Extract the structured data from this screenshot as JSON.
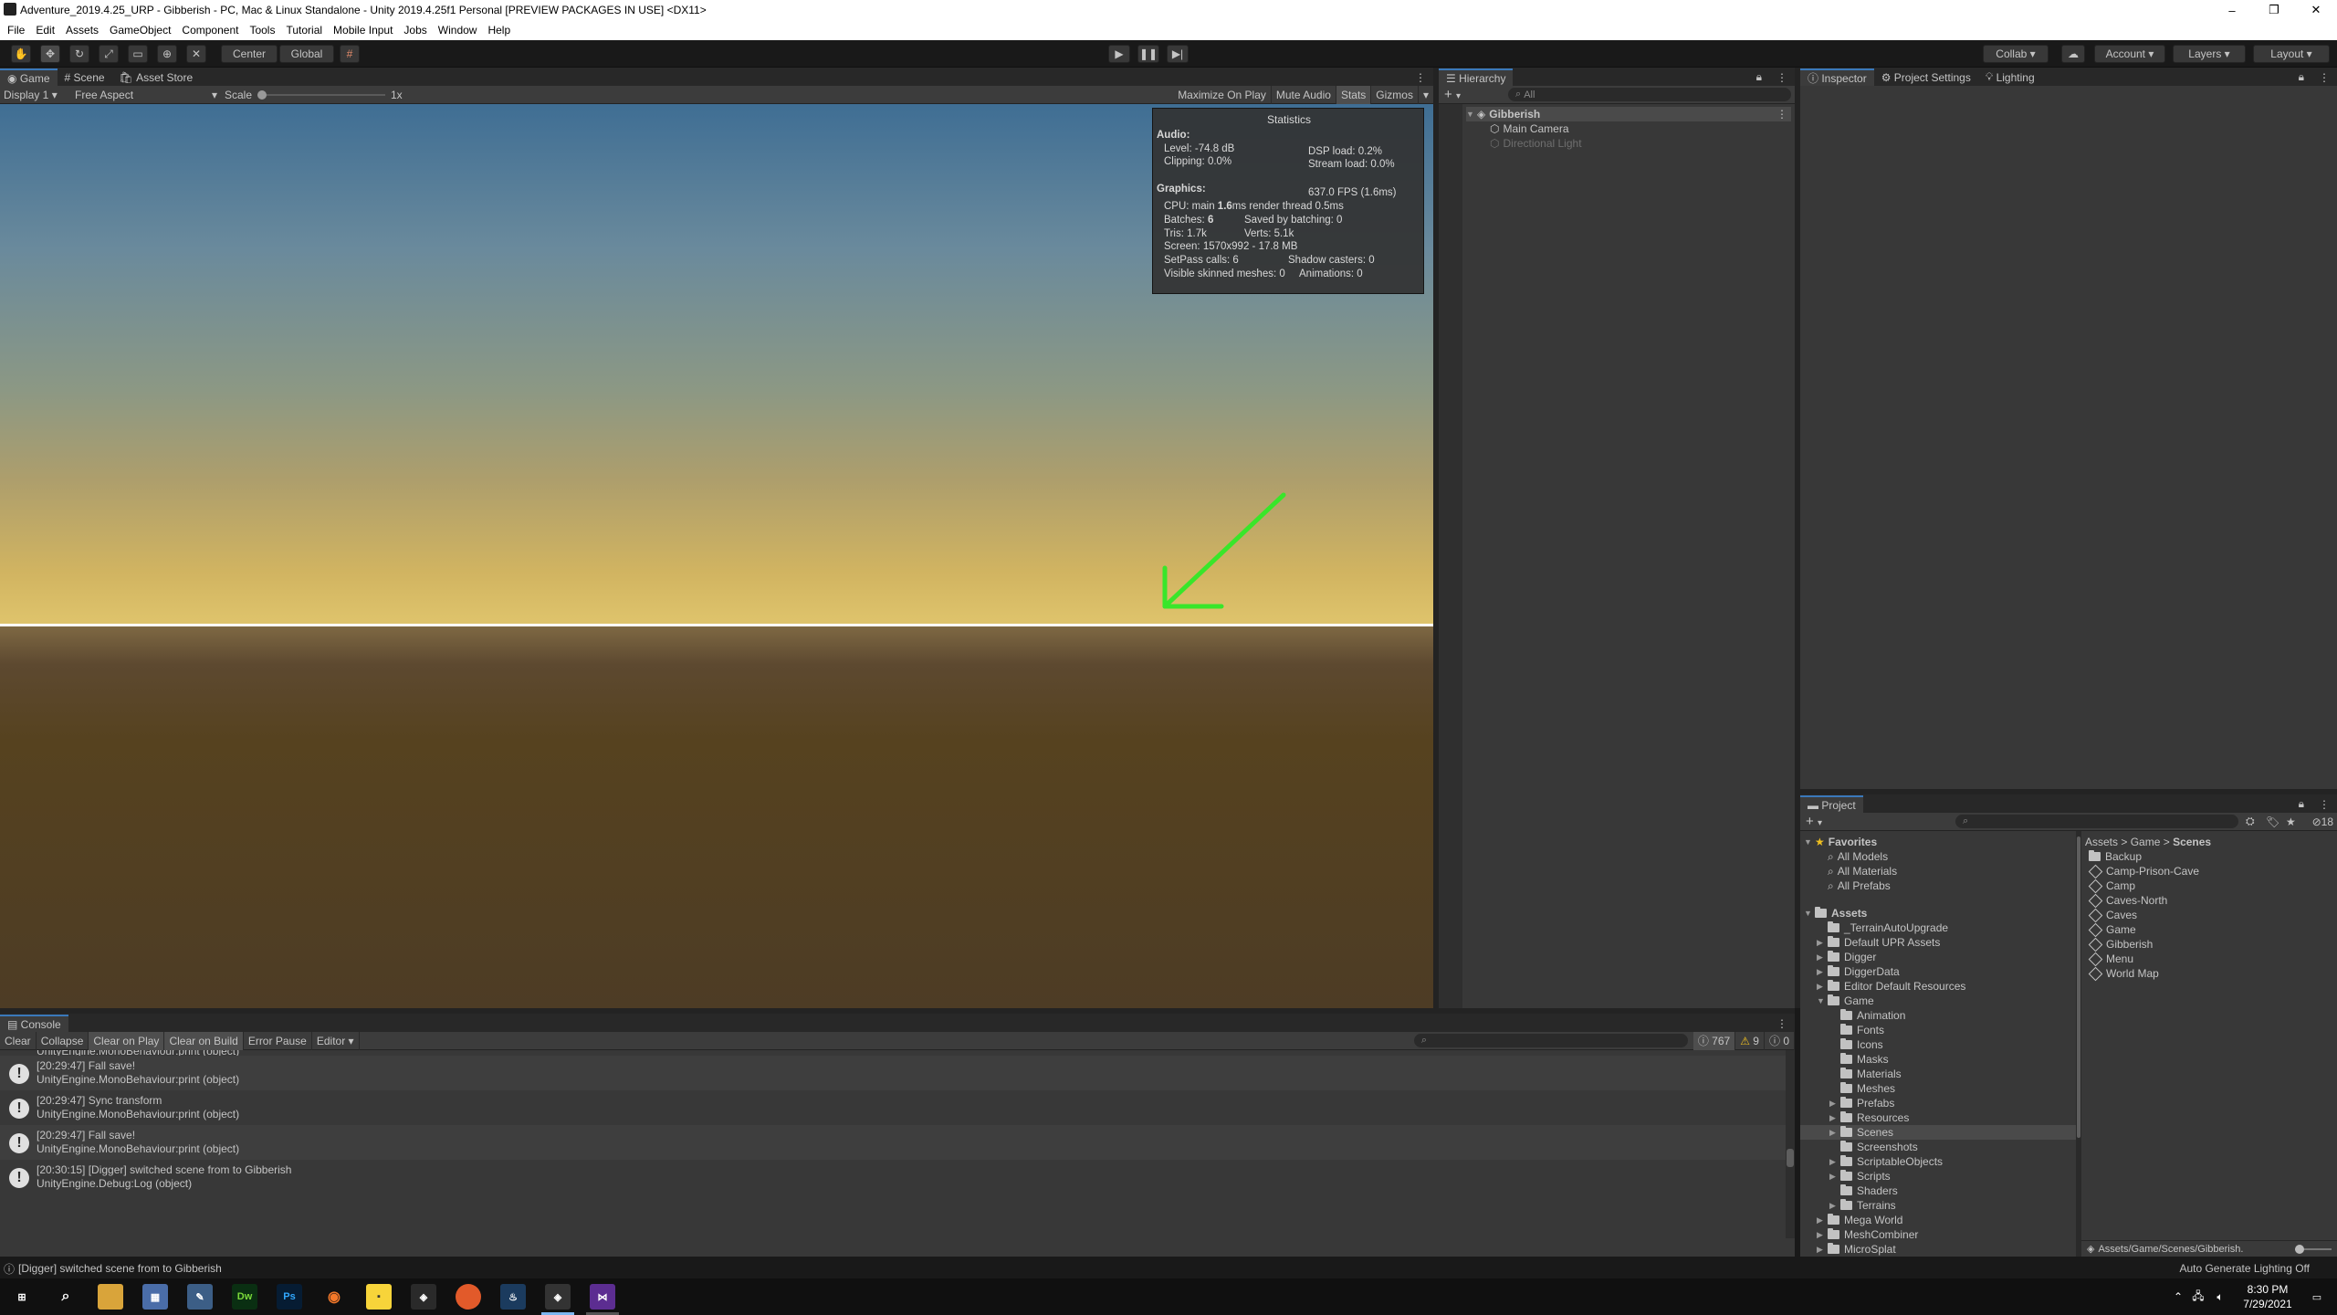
{
  "window": {
    "title": "Adventure_2019.4.25_URP - Gibberish - PC, Mac & Linux Standalone - Unity 2019.4.25f1 Personal [PREVIEW PACKAGES IN USE] <DX11>",
    "controls": [
      "–",
      "❐",
      "✕"
    ]
  },
  "menu": [
    "File",
    "Edit",
    "Assets",
    "GameObject",
    "Component",
    "Tools",
    "Tutorial",
    "Mobile Input",
    "Jobs",
    "Window",
    "Help"
  ],
  "toolbar": {
    "pivot": "Center",
    "space": "Global",
    "collab": "Collab",
    "account": "Account",
    "layers": "Layers",
    "layout": "Layout"
  },
  "game_view": {
    "tabs": [
      "Game",
      "Scene",
      "Asset Store"
    ],
    "display": "Display 1",
    "aspect": "Free Aspect",
    "scale_label": "Scale",
    "scale_value": "1x",
    "buttons": [
      "Maximize On Play",
      "Mute Audio",
      "Stats",
      "Gizmos"
    ],
    "arrow_color": "#39e62a"
  },
  "stats": {
    "title": "Statistics",
    "audio_header": "Audio:",
    "level": "Level: -74.8 dB",
    "clipping": "Clipping: 0.0%",
    "dsp": "DSP load: 0.2%",
    "stream": "Stream load: 0.0%",
    "graphics_header": "Graphics:",
    "fps": "637.0 FPS (1.6ms)",
    "cpu_a": "CPU: main ",
    "cpu_b": "1.6",
    "cpu_c": "ms  render thread 0.5ms",
    "batches_a": "Batches: ",
    "batches_b": "6",
    "saved": "Saved by batching: 0",
    "tris": "Tris: 1.7k",
    "verts": "Verts: 5.1k",
    "screen": "Screen: 1570x992 - 17.8 MB",
    "setpass": "SetPass calls: 6",
    "shadow": "Shadow casters: 0",
    "skinned": "Visible skinned meshes: 0",
    "anims": "Animations: 0"
  },
  "hierarchy": {
    "tab": "Hierarchy",
    "search_placeholder": "All",
    "scene": "Gibberish",
    "items": [
      "Main Camera",
      "Directional Light"
    ]
  },
  "inspector": {
    "tabs": [
      "Inspector",
      "Project Settings",
      "Lighting"
    ]
  },
  "project": {
    "tab": "Project",
    "count": "18",
    "favorites_header": "Favorites",
    "favorites": [
      "All Models",
      "All Materials",
      "All Prefabs"
    ],
    "assets_header": "Assets",
    "tree": [
      {
        "label": "_TerrainAutoUpgrade",
        "depth": 1,
        "arrow": ""
      },
      {
        "label": "Default UPR Assets",
        "depth": 1,
        "arrow": "▶"
      },
      {
        "label": "Digger",
        "depth": 1,
        "arrow": "▶"
      },
      {
        "label": "DiggerData",
        "depth": 1,
        "arrow": "▶"
      },
      {
        "label": "Editor Default Resources",
        "depth": 1,
        "arrow": "▶"
      },
      {
        "label": "Game",
        "depth": 1,
        "arrow": "▼"
      },
      {
        "label": "Animation",
        "depth": 2,
        "arrow": ""
      },
      {
        "label": "Fonts",
        "depth": 2,
        "arrow": ""
      },
      {
        "label": "Icons",
        "depth": 2,
        "arrow": ""
      },
      {
        "label": "Masks",
        "depth": 2,
        "arrow": ""
      },
      {
        "label": "Materials",
        "depth": 2,
        "arrow": ""
      },
      {
        "label": "Meshes",
        "depth": 2,
        "arrow": ""
      },
      {
        "label": "Prefabs",
        "depth": 2,
        "arrow": "▶"
      },
      {
        "label": "Resources",
        "depth": 2,
        "arrow": "▶"
      },
      {
        "label": "Scenes",
        "depth": 2,
        "arrow": "▶"
      },
      {
        "label": "Screenshots",
        "depth": 2,
        "arrow": ""
      },
      {
        "label": "ScriptableObjects",
        "depth": 2,
        "arrow": "▶"
      },
      {
        "label": "Scripts",
        "depth": 2,
        "arrow": "▶"
      },
      {
        "label": "Shaders",
        "depth": 2,
        "arrow": ""
      },
      {
        "label": "Terrains",
        "depth": 2,
        "arrow": "▶"
      },
      {
        "label": "Mega World",
        "depth": 1,
        "arrow": "▶"
      },
      {
        "label": "MeshCombiner",
        "depth": 1,
        "arrow": "▶"
      },
      {
        "label": "MicroSplat",
        "depth": 1,
        "arrow": "▶"
      }
    ],
    "selected_folder": "Scenes",
    "breadcrumb": [
      "Assets",
      "Game",
      "Scenes"
    ],
    "contents": [
      {
        "label": "Backup",
        "kind": "folder"
      },
      {
        "label": "Camp-Prison-Cave",
        "kind": "scene"
      },
      {
        "label": "Camp",
        "kind": "scene"
      },
      {
        "label": "Caves-North",
        "kind": "scene"
      },
      {
        "label": "Caves",
        "kind": "scene"
      },
      {
        "label": "Game",
        "kind": "scene"
      },
      {
        "label": "Gibberish",
        "kind": "scene"
      },
      {
        "label": "Menu",
        "kind": "scene"
      },
      {
        "label": "World Map",
        "kind": "scene"
      }
    ],
    "path": "Assets/Game/Scenes/Gibberish."
  },
  "console": {
    "tab": "Console",
    "buttons": [
      "Clear",
      "Collapse",
      "Clear on Play",
      "Clear on Build",
      "Error Pause",
      "Editor"
    ],
    "log_count": "767",
    "warn_count": "9",
    "error_count": "0",
    "partial_top": "UnityEngine.MonoBehaviour:print (object)",
    "rows": [
      {
        "msg": "[20:29:47] Fall save!",
        "trace": "UnityEngine.MonoBehaviour:print (object)"
      },
      {
        "msg": "[20:29:47] Sync transform",
        "trace": "UnityEngine.MonoBehaviour:print (object)"
      },
      {
        "msg": "[20:29:47] Fall save!",
        "trace": "UnityEngine.MonoBehaviour:print (object)"
      },
      {
        "msg": "[20:30:15] [Digger] switched scene from  to Gibberish",
        "trace": "UnityEngine.Debug:Log (object)"
      }
    ]
  },
  "status": {
    "message": "[Digger] switched scene from  to Gibberish",
    "lighting": "Auto Generate Lighting Off"
  },
  "taskbar": {
    "time": "8:30 PM",
    "date": "7/29/2021"
  }
}
